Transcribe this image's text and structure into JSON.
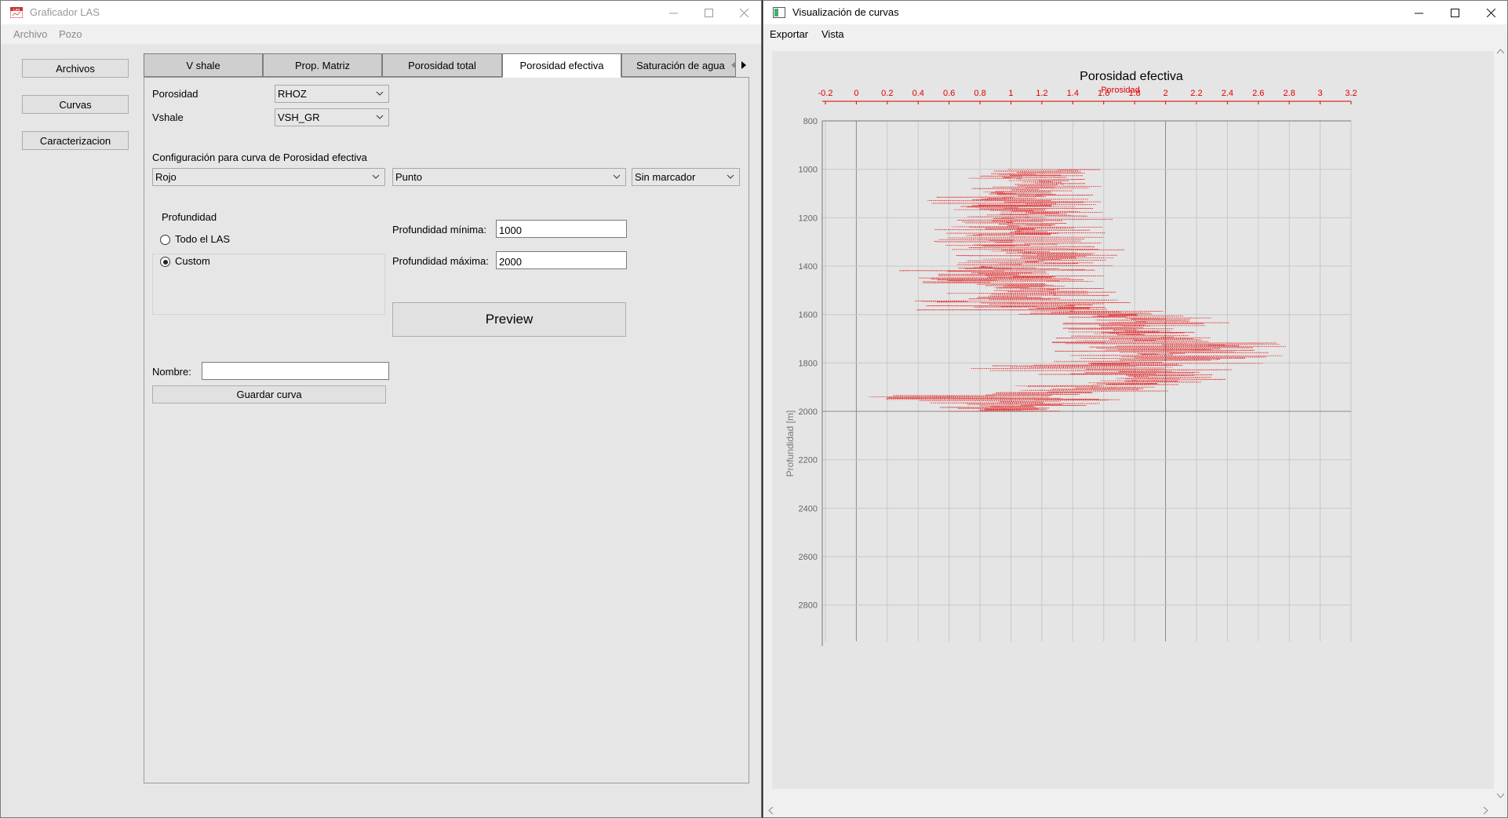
{
  "left_window": {
    "title": "Graficador LAS",
    "app_icon_text": "LAS",
    "menu": [
      "Archivo",
      "Pozo"
    ],
    "sidebar_buttons": [
      "Archivos",
      "Curvas",
      "Caracterizacion"
    ],
    "tabs": [
      "V shale",
      "Prop. Matriz",
      "Porosidad total",
      "Porosidad efectiva",
      "Saturación de agua"
    ],
    "active_tab": "Porosidad efectiva",
    "form": {
      "porosidad_label": "Porosidad",
      "porosidad_value": "RHOZ",
      "vshale_label": "Vshale",
      "vshale_value": "VSH_GR",
      "config_label": "Configuración para curva de Porosidad efectiva",
      "color_value": "Rojo",
      "line_style_value": "Punto",
      "marker_value": "Sin marcador",
      "profundidad_group": "Profundidad",
      "radio_all": "Todo el LAS",
      "radio_custom": "Custom",
      "radio_selected": "Custom",
      "prof_min_label": "Profundidad mínima:",
      "prof_min_value": "1000",
      "prof_max_label": "Profundidad máxima:",
      "prof_max_value": "2000",
      "preview_button": "Preview",
      "nombre_label": "Nombre:",
      "nombre_value": "",
      "guardar_button": "Guardar curva"
    }
  },
  "right_window": {
    "title": "Visualización de curvas",
    "menu": [
      "Exportar",
      "Vista"
    ]
  },
  "colors": {
    "curve": "#e00000",
    "grid": "#c8c8c8"
  },
  "chart_data": {
    "type": "line",
    "title": "Porosidad efectiva",
    "xlabel": "Porosidad",
    "ylabel": "Profundidad [m]",
    "x_axis_position": "top",
    "y_inverted": true,
    "xlim": [
      -0.2,
      3.2
    ],
    "ylim": [
      800,
      2950
    ],
    "x_ticks": [
      "-0.2",
      "0",
      "0.2",
      "0.4",
      "0.6",
      "0.8",
      "1",
      "1.2",
      "1.4",
      "1.6",
      "1.8",
      "2",
      "2.2",
      "2.4",
      "2.6",
      "2.8",
      "3",
      "3.2"
    ],
    "y_ticks": [
      "800",
      "1000",
      "1200",
      "1400",
      "1600",
      "1800",
      "2000",
      "2200",
      "2400",
      "2600",
      "2800"
    ],
    "grid": true,
    "series": [
      {
        "name": "Porosidad",
        "color": "#e00000",
        "style": "dotted",
        "depth_range": [
          1000,
          2000
        ],
        "envelope": [
          {
            "depth": 1000,
            "min": 0.72,
            "max": 1.58
          },
          {
            "depth": 1050,
            "min": 0.72,
            "max": 1.62
          },
          {
            "depth": 1100,
            "min": 0.55,
            "max": 1.55
          },
          {
            "depth": 1140,
            "min": 0.38,
            "max": 1.6
          },
          {
            "depth": 1180,
            "min": 0.55,
            "max": 1.68
          },
          {
            "depth": 1220,
            "min": 0.6,
            "max": 1.68
          },
          {
            "depth": 1260,
            "min": 0.42,
            "max": 1.65
          },
          {
            "depth": 1300,
            "min": 0.5,
            "max": 1.72
          },
          {
            "depth": 1340,
            "min": 0.62,
            "max": 1.74
          },
          {
            "depth": 1380,
            "min": 0.65,
            "max": 1.7
          },
          {
            "depth": 1420,
            "min": 0.25,
            "max": 1.7
          },
          {
            "depth": 1460,
            "min": 0.35,
            "max": 1.68
          },
          {
            "depth": 1500,
            "min": 0.68,
            "max": 1.72
          },
          {
            "depth": 1540,
            "min": 0.3,
            "max": 1.75
          },
          {
            "depth": 1580,
            "min": 0.27,
            "max": 2.2
          },
          {
            "depth": 1620,
            "min": 1.2,
            "max": 2.62
          },
          {
            "depth": 1660,
            "min": 1.3,
            "max": 2.15
          },
          {
            "depth": 1700,
            "min": 1.28,
            "max": 2.58
          },
          {
            "depth": 1740,
            "min": 1.22,
            "max": 3.0
          },
          {
            "depth": 1780,
            "min": 1.35,
            "max": 2.72
          },
          {
            "depth": 1820,
            "min": 0.6,
            "max": 2.68
          },
          {
            "depth": 1860,
            "min": 1.4,
            "max": 2.5
          },
          {
            "depth": 1900,
            "min": 0.95,
            "max": 2.5
          },
          {
            "depth": 1940,
            "min": 0.05,
            "max": 1.8
          },
          {
            "depth": 1970,
            "min": 0.4,
            "max": 1.6
          },
          {
            "depth": 2000,
            "min": 0.6,
            "max": 1.45
          }
        ]
      }
    ]
  }
}
